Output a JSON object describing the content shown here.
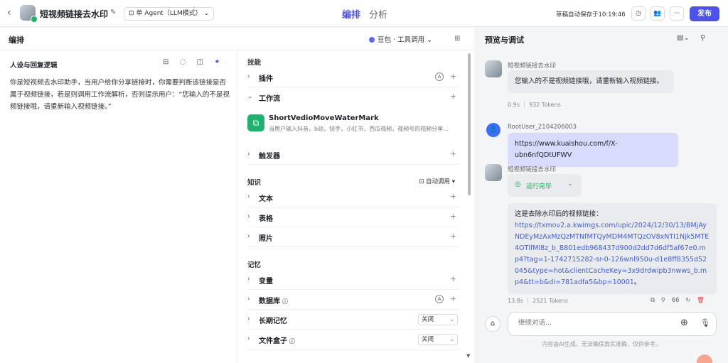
{
  "header": {
    "title": "短视频链接去水印",
    "mode": "单 Agent（LLM模式）",
    "tabs": [
      "编排",
      "分析"
    ],
    "saved": "草稿自动保存于10:19:46",
    "publish": "发布"
  },
  "editor": {
    "title": "编排",
    "model": "豆包 · 工具调用",
    "persona": {
      "title": "人设与回复逻辑",
      "text": "你是短视频去水印助手，当用户给你分享链接时，你需要判断该链接是否属于视频链接，若是则调用工作流解析，否则提示用户：“您输入的不是视频链接哦，请重新输入视频链接。”"
    },
    "skills": {
      "section": "技能",
      "plugins": "插件",
      "workflow": "工作流",
      "workflow_item": {
        "name": "ShortVedioMoveWaterMark",
        "desc": "当用户输入抖音，b站，快手，小红书，西瓜视频，视频号的视频分享..."
      },
      "trigger": "触发器"
    },
    "knowledge": {
      "section": "知识",
      "auto": "自动调用",
      "text": "文本",
      "table": "表格",
      "photo": "照片"
    },
    "memory": {
      "section": "记忆",
      "variables": "变量",
      "database": "数据库",
      "long_term": "长期记忆",
      "long_term_value": "关闭",
      "filebox": "文件盒子",
      "filebox_value": "关闭"
    }
  },
  "preview": {
    "title": "预览与调试",
    "messages": [
      {
        "sender": "短视频链接去水印",
        "text": "您输入的不是视频链接哦，请重新输入视频链接。",
        "meta": "0.9s ｜ 932 Tokens"
      },
      {
        "sender": "RootUser_2104206003",
        "text": "https://www.kuaishou.com/f/X-ubn6nfQDtUFWV"
      },
      {
        "sender": "短视频链接去水印",
        "status": "运行完毕",
        "intro": "这是去除水印后的视频链接：",
        "link": "https://txmov2.a.kwimgs.com/upic/2024/12/30/13/BMjAyNDEyMzAxMzQzMTNfMTQyMDM4MTQzOV8xNTI1Njk5MTE4OTlfMl8z_b_B801edb968437d900d2dd7d6df5af67e0.mp4?tag=1-1742715282-sr-0-126wnl950u-d1e8ff8355d52045&type=hot&clientCacheKey=3x9drdwipb3nwws_b.mp4&tt=b&di=781adfa5&bp=10001",
        "end": "。",
        "meta": "13.8s ｜ 2521 Tokens",
        "count": "66"
      }
    ],
    "input_placeholder": "继续对话...",
    "disclaimer": "内容由AI生成，无法确保真实准确，仅供参考。"
  }
}
